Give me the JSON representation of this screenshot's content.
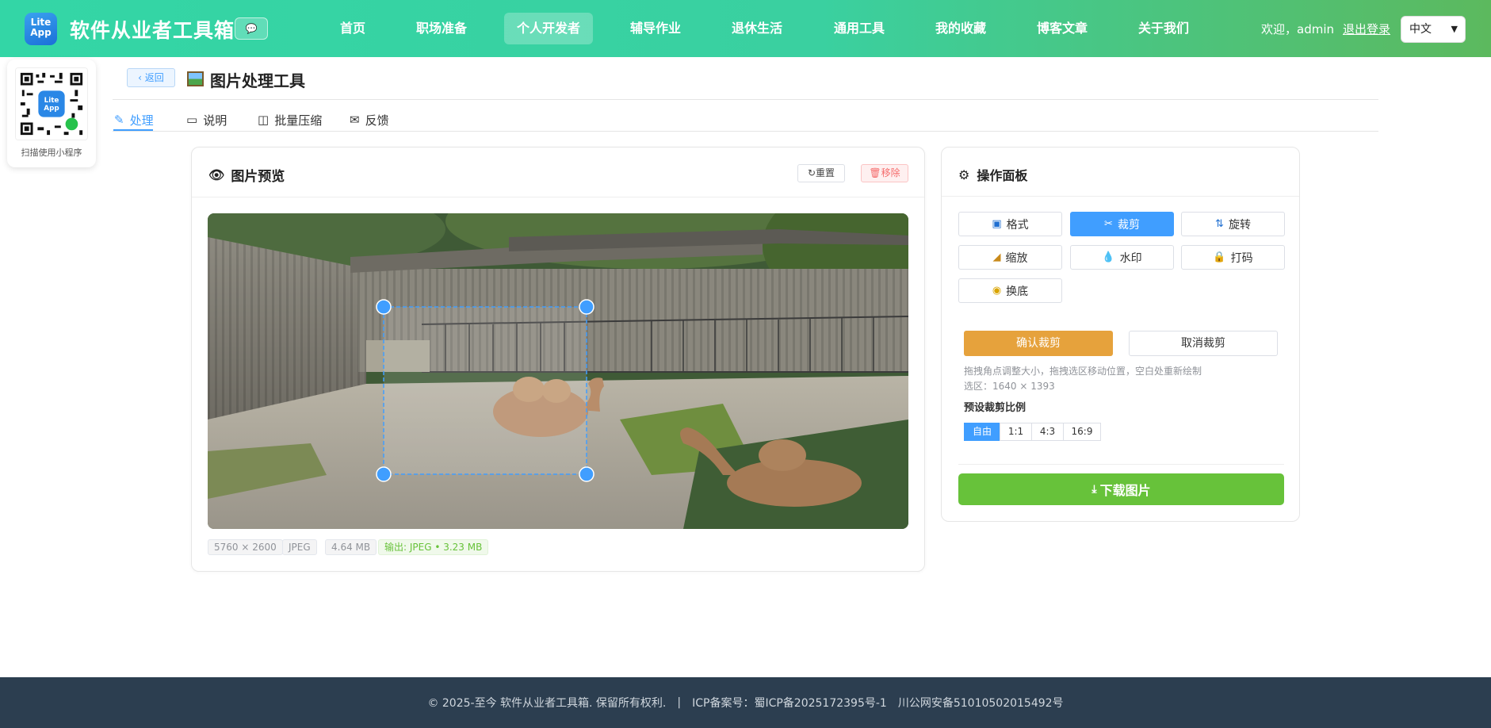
{
  "header": {
    "logo_text": "Lite App",
    "brand": "软件从业者工具箱",
    "chat_icon": "chat-bubble-icon",
    "nav": [
      {
        "label": "首页"
      },
      {
        "label": "职场准备"
      },
      {
        "label": "个人开发者"
      },
      {
        "label": "辅导作业"
      },
      {
        "label": "退休生活"
      },
      {
        "label": "通用工具"
      },
      {
        "label": "我的收藏"
      },
      {
        "label": "博客文章"
      },
      {
        "label": "关于我们"
      }
    ],
    "active_nav": "个人开发者",
    "welcome": "欢迎，admin",
    "logout": "退出登录",
    "language": "中文"
  },
  "qr": {
    "logo_text": "Lite App",
    "label": "扫描使用小程序"
  },
  "title_bar": {
    "back_label": "返回",
    "title": "图片处理工具"
  },
  "tabs": [
    {
      "label": "处理",
      "icon": "edit-icon"
    },
    {
      "label": "说明",
      "icon": "book-icon"
    },
    {
      "label": "批量压缩",
      "icon": "compress-icon"
    },
    {
      "label": "反馈",
      "icon": "comment-icon"
    }
  ],
  "preview": {
    "title": "图片预览",
    "reset_label": "重置",
    "remove_label": "移除",
    "info": {
      "dimensions": "5760 × 2600",
      "format": "JPEG",
      "size": "4.64 MB",
      "output": "输出: JPEG • 3.23 MB"
    }
  },
  "panel": {
    "title": "操作面板",
    "tools": [
      {
        "label": "格式",
        "icon": "format-icon"
      },
      {
        "label": "裁剪",
        "icon": "scissors-icon"
      },
      {
        "label": "旋转",
        "icon": "rotate-icon"
      },
      {
        "label": "缩放",
        "icon": "ruler-icon"
      },
      {
        "label": "水印",
        "icon": "droplet-icon"
      },
      {
        "label": "打码",
        "icon": "lock-icon"
      },
      {
        "label": "换底",
        "icon": "palette-icon"
      }
    ],
    "active_tool": "裁剪",
    "confirm_crop": "确认裁剪",
    "cancel_crop": "取消裁剪",
    "hint": "拖拽角点调整大小，拖拽选区移动位置，空白处重新绘制",
    "selection": "选区：1640 × 1393",
    "ratio_title": "预设裁剪比例",
    "ratios": [
      "自由",
      "1:1",
      "4:3",
      "16:9"
    ],
    "active_ratio": "自由",
    "download": "下载图片"
  },
  "footer": {
    "copyright": "© 2025-至今 软件从业者工具箱. 保留所有权利.",
    "separator": "|",
    "icp": "ICP备案号：蜀ICP备2025172395号-1",
    "police": "川公网安备51010502015492号"
  },
  "colors": {
    "header_start": "#33d6a6",
    "header_end": "#5cb95e",
    "primary": "#409eff",
    "warning": "#e6a23c",
    "success": "#67c23a",
    "footer_bg": "#2c3e50"
  }
}
